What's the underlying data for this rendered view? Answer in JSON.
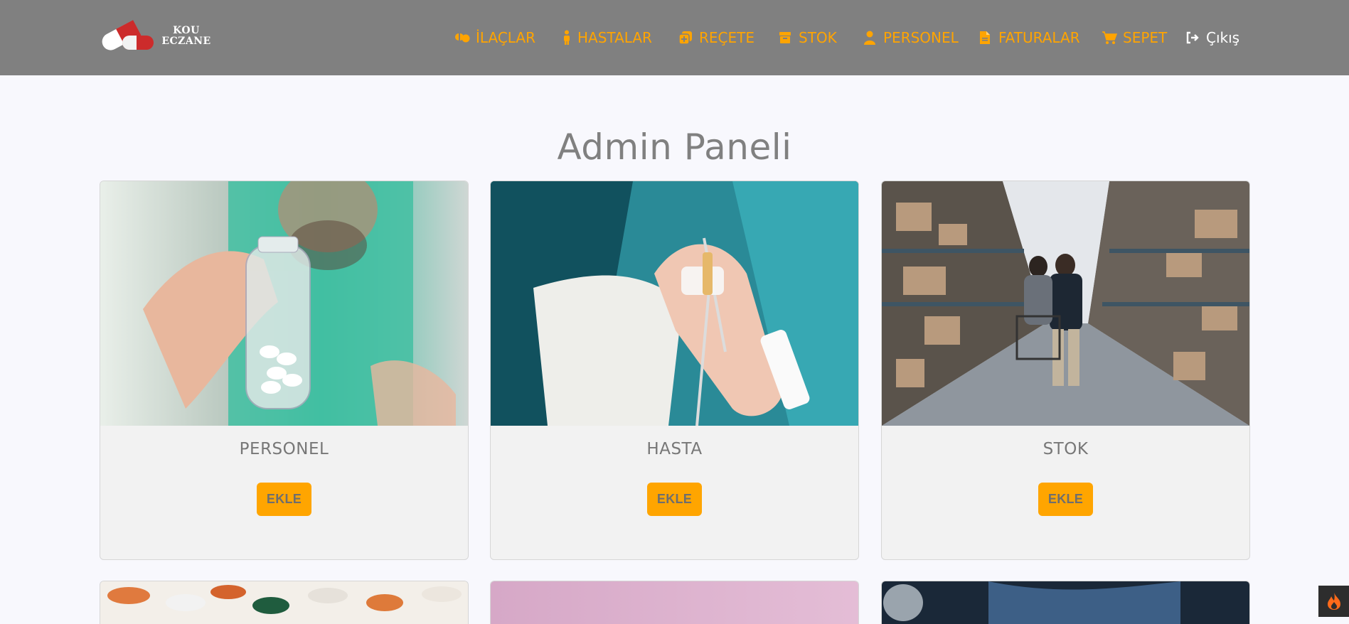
{
  "logo": {
    "line1": "KOU",
    "line2": "ECZANE"
  },
  "nav": {
    "items": [
      {
        "label": "İLAÇLAR",
        "icon": "pills-icon"
      },
      {
        "label": "HASTALAR",
        "icon": "person-icon"
      },
      {
        "label": "REÇETE",
        "icon": "prescription-icon"
      },
      {
        "label": "STOK",
        "icon": "box-icon"
      },
      {
        "label": "PERSONEL",
        "icon": "user-icon"
      },
      {
        "label": "FATURALAR",
        "icon": "file-icon"
      },
      {
        "label": "SEPET",
        "icon": "cart-icon"
      }
    ],
    "logout": {
      "label": "Çıkış",
      "icon": "sign-out-icon"
    }
  },
  "page": {
    "title": "Admin Paneli"
  },
  "cards": [
    {
      "title": "PERSONEL",
      "button": "EKLE",
      "image": "pharmacist-holding-pill-bottle"
    },
    {
      "title": "HASTA",
      "button": "EKLE",
      "image": "patient-hand-with-iv"
    },
    {
      "title": "STOK",
      "button": "EKLE",
      "image": "warehouse-aisle"
    }
  ],
  "colors": {
    "navbar": "#808080",
    "accent": "#ffa400",
    "background": "#f8f8fd",
    "card": "#f2f2f2",
    "title": "#808080"
  }
}
